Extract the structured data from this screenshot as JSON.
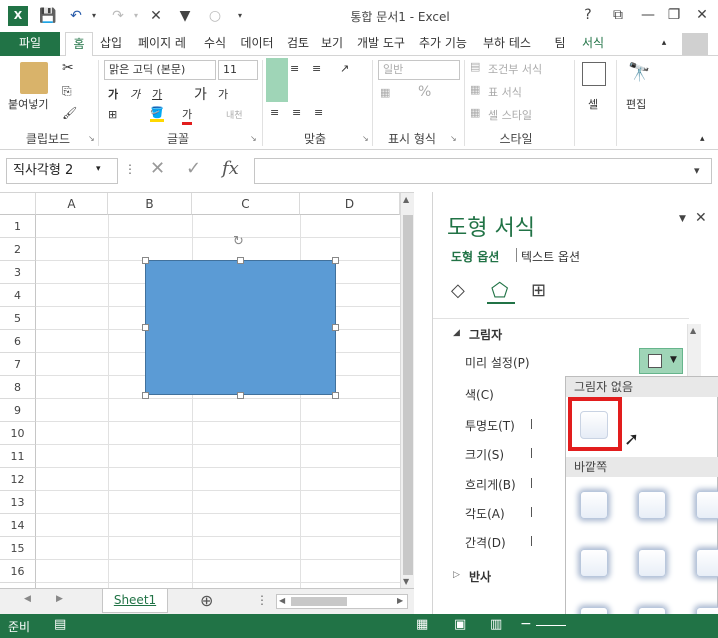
{
  "titlebar": {
    "title": "통합 문서1 - Excel",
    "help": "?",
    "minimize": "—",
    "restore": "❐",
    "close": "✕"
  },
  "tabs": [
    "파일",
    "홈",
    "삽입",
    "페이지 레",
    "수식",
    "데이터",
    "검토",
    "보기",
    "개발 도구",
    "추가 기능",
    "부하 테스",
    "팀",
    "서식"
  ],
  "ribbon": {
    "clipboard": {
      "paste": "붙여넣기",
      "label": "클립보드"
    },
    "font": {
      "name": "맑은 고딕 (본문)",
      "size": "11",
      "bold": "가",
      "italic": "가",
      "underline": "가",
      "grow": "가",
      "shrink": "가",
      "phonetic": "내천",
      "label": "글꼴"
    },
    "align": {
      "label": "맞춤"
    },
    "number": {
      "format": "일반",
      "percent": "%",
      "label": "표시 형식"
    },
    "styles": {
      "conditional": "조건부 서식",
      "table": "표 서식",
      "cell": "셀 스타일",
      "label": "스타일"
    },
    "cells": {
      "label": "셀"
    },
    "editing": {
      "label": "편집"
    }
  },
  "formula_bar": {
    "name_box": "직사각형 2",
    "cancel": "✕",
    "enter": "✓",
    "fx": "fx",
    "value": ""
  },
  "sheet": {
    "columns": [
      "A",
      "B",
      "C",
      "D"
    ],
    "rows": [
      "1",
      "2",
      "3",
      "4",
      "5",
      "6",
      "7",
      "8",
      "9",
      "10",
      "11",
      "12",
      "13",
      "14",
      "15",
      "16",
      "17"
    ],
    "tab": "Sheet1",
    "add_sheet": "⊕"
  },
  "status": {
    "ready": "준비"
  },
  "pane": {
    "title": "도형 서식",
    "shape_options": "도형 옵션",
    "text_options": "텍스트 옵션",
    "section_shadow": "그림자",
    "presets": "미리 설정(P)",
    "color": "색(C)",
    "transparency": "투명도(T)",
    "size": "크기(S)",
    "blur": "흐리게(B)",
    "angle": "각도(A)",
    "distance": "간격(D)",
    "section_reflection": "반사"
  },
  "gallery": {
    "no_shadow": "그림자 없음",
    "outer": "바깥쪽"
  },
  "colors": {
    "excel_green": "#217346",
    "shape_fill": "#5b9bd5",
    "highlight_red": "#e21d1d"
  }
}
